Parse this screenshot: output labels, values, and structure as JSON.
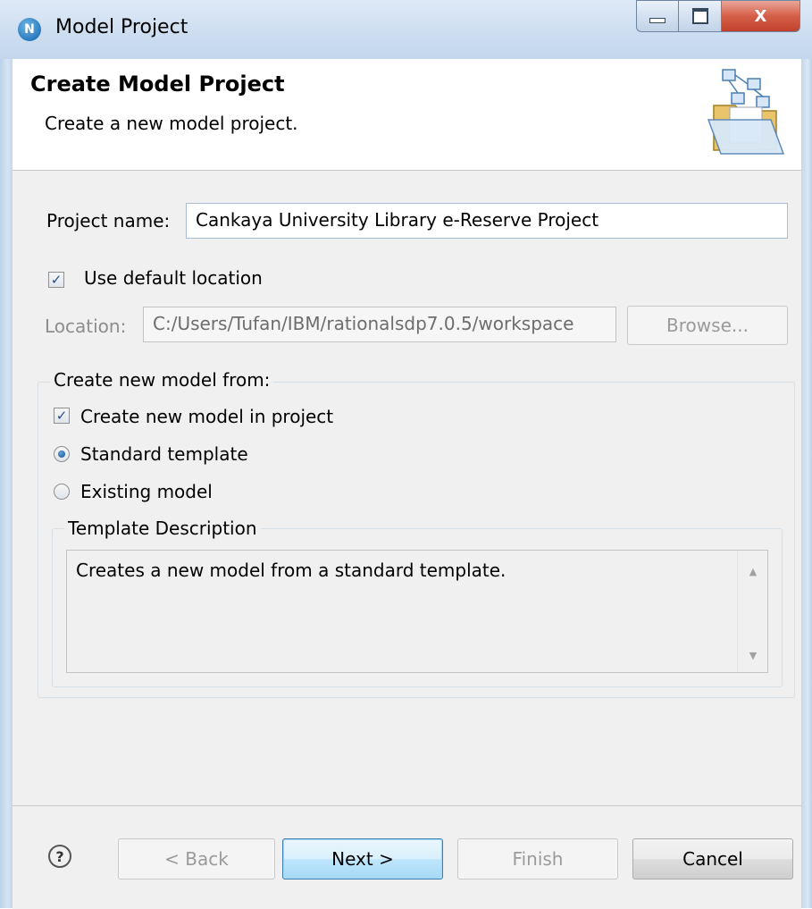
{
  "window": {
    "title": "Model Project",
    "app_icon_glyph": "N",
    "controls": {
      "close_glyph": "X"
    }
  },
  "header": {
    "title": "Create Model Project",
    "subtitle": "Create a new model project.",
    "banner_icon": "folder-model-icon"
  },
  "form": {
    "project_name_label": "Project name:",
    "project_name_value": "Cankaya University Library e-Reserve Project",
    "use_default_location_label": "Use default location",
    "use_default_location_checked": true,
    "location_label": "Location:",
    "location_value": "C:/Users/Tufan/IBM/rationalsdp7.0.5/workspace",
    "browse_label": "Browse..."
  },
  "model_group": {
    "legend": "Create new model from:",
    "create_in_project_label": "Create new model in project",
    "create_in_project_checked": true,
    "options": [
      {
        "label": "Standard template",
        "selected": true
      },
      {
        "label": "Existing model",
        "selected": false
      }
    ],
    "template_description": {
      "legend": "Template Description",
      "text": "Creates a new model from a standard template."
    }
  },
  "footer": {
    "help_glyph": "?",
    "back_label": "< Back",
    "next_label": "Next >",
    "finish_label": "Finish",
    "cancel_label": "Cancel"
  },
  "colors": {
    "window_frame": "#c3d6ec",
    "close_button": "#d65f48",
    "default_button_border": "#3c7fb1",
    "dialog_background": "#f0f0f0"
  }
}
